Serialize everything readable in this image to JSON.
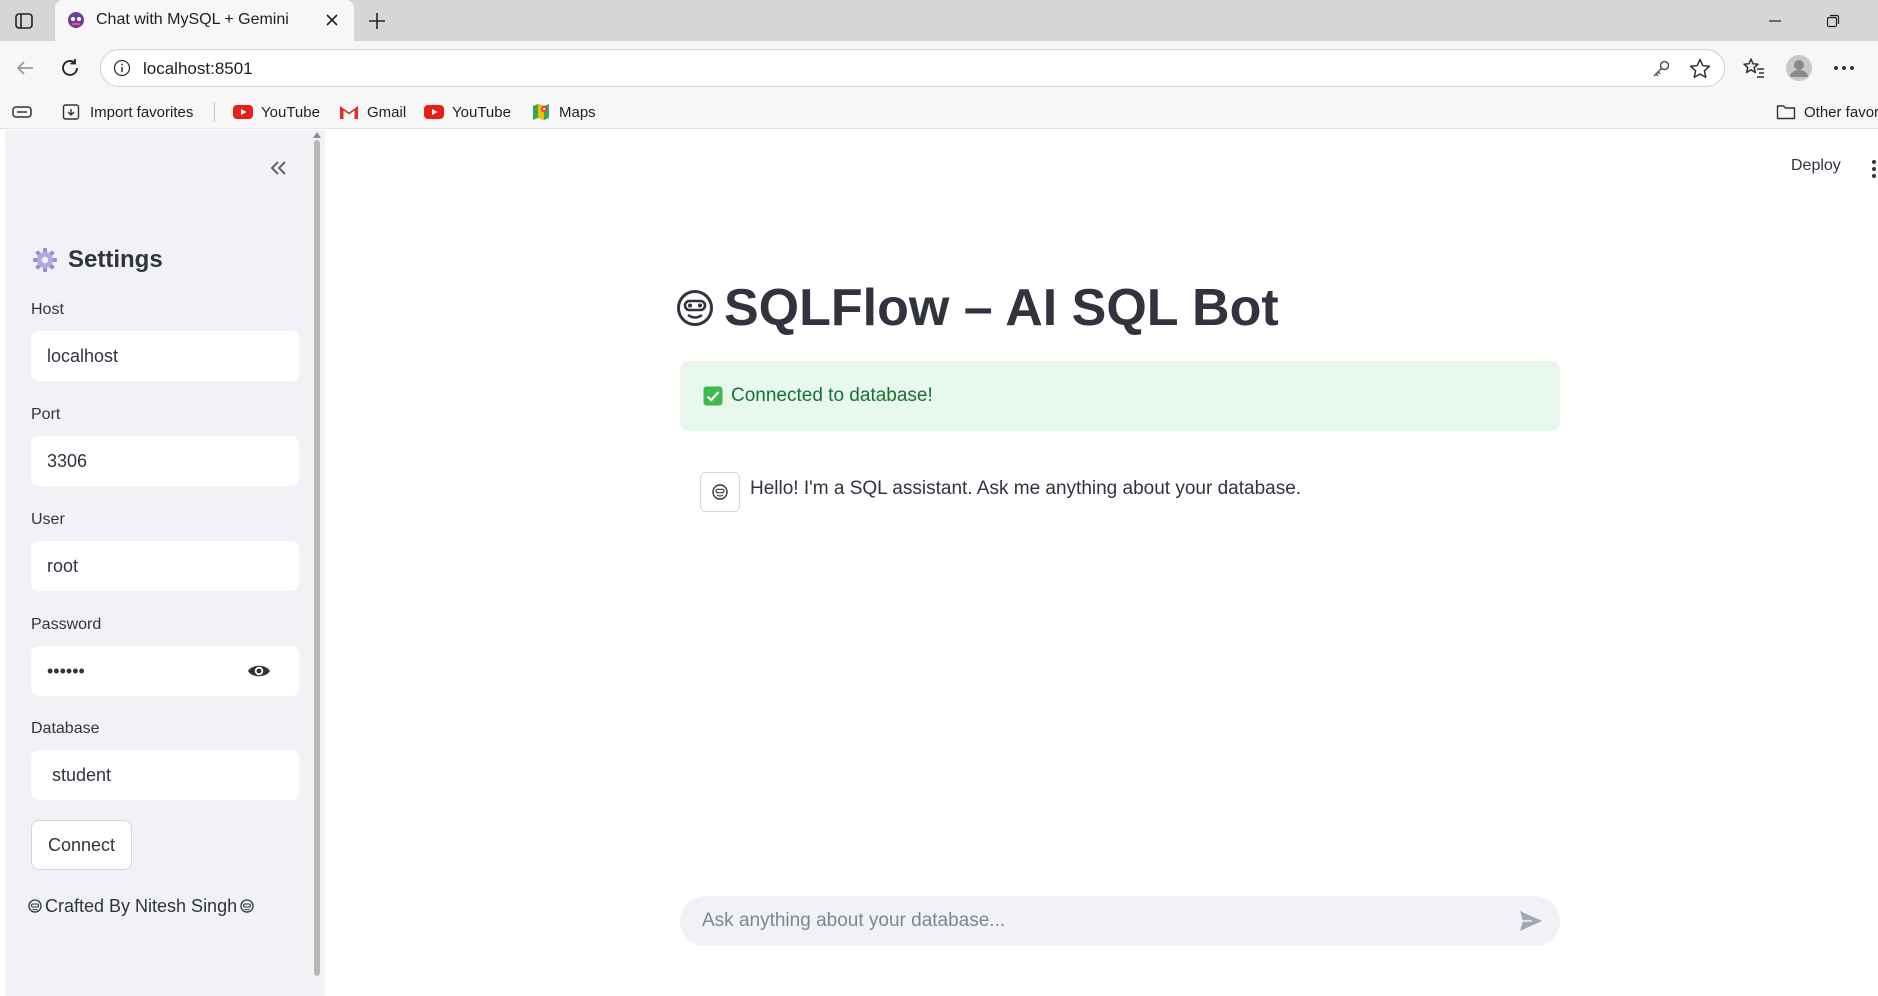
{
  "browser": {
    "tab_title": "Chat with MySQL + Gemini",
    "url": "localhost:8501",
    "bookmarks": [
      {
        "label": "Import favorites",
        "icon": "import-favorites-icon"
      },
      {
        "label": "YouTube",
        "icon": "youtube-icon"
      },
      {
        "label": "Gmail",
        "icon": "gmail-icon"
      },
      {
        "label": "YouTube",
        "icon": "youtube-icon"
      },
      {
        "label": "Maps",
        "icon": "maps-icon"
      }
    ],
    "other_favorites": "Other favor"
  },
  "sidebar": {
    "header": "Settings",
    "header_icon": "gear-icon",
    "fields": {
      "host": {
        "label": "Host",
        "value": "localhost"
      },
      "port": {
        "label": "Port",
        "value": "3306"
      },
      "user": {
        "label": "User",
        "value": "root"
      },
      "password": {
        "label": "Password",
        "value": "••••••"
      },
      "database": {
        "label": "Database",
        "value": " student"
      }
    },
    "connect_label": "Connect",
    "credit": "Crafted By Nitesh Singh"
  },
  "main": {
    "deploy_label": "Deploy",
    "title": "SQLFlow – AI SQL Bot",
    "alert_text": "Connected to database!",
    "messages": [
      {
        "role": "assistant",
        "text": "Hello! I'm a SQL assistant. Ask me anything about your database."
      }
    ],
    "chat_placeholder": "Ask anything about your database..."
  },
  "colors": {
    "sidebar_bg": "#f0f2f6",
    "alert_bg": "#e8f8ec",
    "alert_text": "#177233",
    "text": "#31333f"
  }
}
